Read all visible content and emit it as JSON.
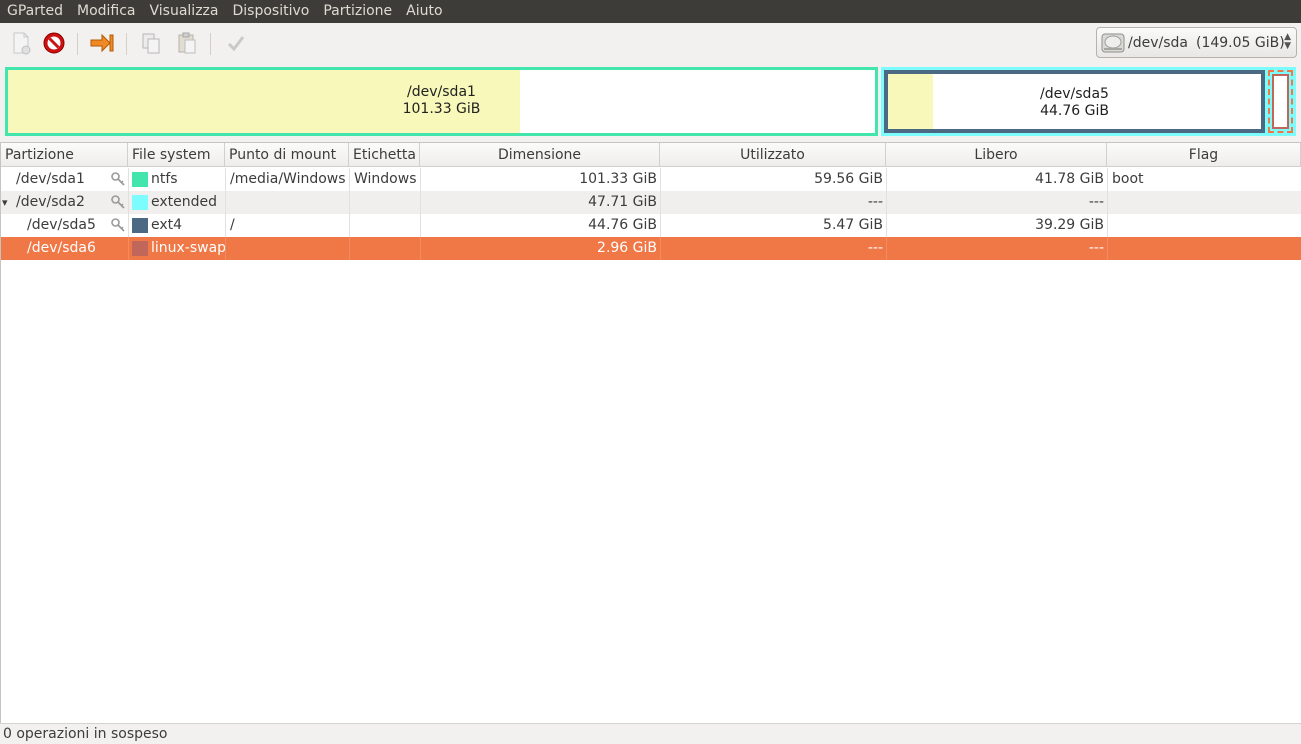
{
  "menubar": {
    "items": [
      "GParted",
      "Modifica",
      "Visualizza",
      "Dispositivo",
      "Partizione",
      "Aiuto"
    ]
  },
  "toolbar": {
    "buttons": [
      "new-partition",
      "delete-partition",
      "resize-move",
      "copy",
      "paste",
      "apply"
    ]
  },
  "device_selector": {
    "device": "/dev/sda",
    "size": "(149.05 GiB)"
  },
  "disk_map": {
    "sda1": {
      "name": "/dev/sda1",
      "size": "101.33 GiB",
      "used_fraction": 0.59
    },
    "sda5": {
      "name": "/dev/sda5",
      "size": "44.76 GiB",
      "used_fraction": 0.12
    }
  },
  "table": {
    "headers": [
      "Partizione",
      "File system",
      "Punto di mount",
      "Etichetta",
      "Dimensione",
      "Utilizzato",
      "Libero",
      "Flag"
    ],
    "rows": [
      {
        "partition": "/dev/sda1",
        "fs": "ntfs",
        "fs_color": "#42e5ac",
        "mount": "/media/Windows",
        "label": "Windows",
        "size": "101.33 GiB",
        "used": "59.56 GiB",
        "free": "41.78 GiB",
        "flag": "boot",
        "mounted": true,
        "indent": 1
      },
      {
        "partition": "/dev/sda2",
        "fs": "extended",
        "fs_color": "#7dfcfe",
        "mount": "",
        "label": "",
        "size": "47.71 GiB",
        "used": "---",
        "free": "---",
        "flag": "",
        "mounted": true,
        "indent": 1,
        "expander": "▾"
      },
      {
        "partition": "/dev/sda5",
        "fs": "ext4",
        "fs_color": "#4b6983",
        "mount": "/",
        "label": "",
        "size": "44.76 GiB",
        "used": "5.47 GiB",
        "free": "39.29 GiB",
        "flag": "",
        "mounted": true,
        "indent": 2
      },
      {
        "partition": "/dev/sda6",
        "fs": "linux-swap",
        "fs_color": "#c1665a",
        "mount": "",
        "label": "",
        "size": "2.96 GiB",
        "used": "---",
        "free": "---",
        "flag": "",
        "mounted": false,
        "indent": 2,
        "selected": true
      }
    ]
  },
  "colors": {
    "selection": "#f07746",
    "ntfs": "#42e5ac",
    "extended": "#7dfcfe",
    "ext4": "#4b6983",
    "swap": "#c1665a",
    "used": "#f8f8ba"
  },
  "statusbar": {
    "text": "0 operazioni in sospeso"
  }
}
